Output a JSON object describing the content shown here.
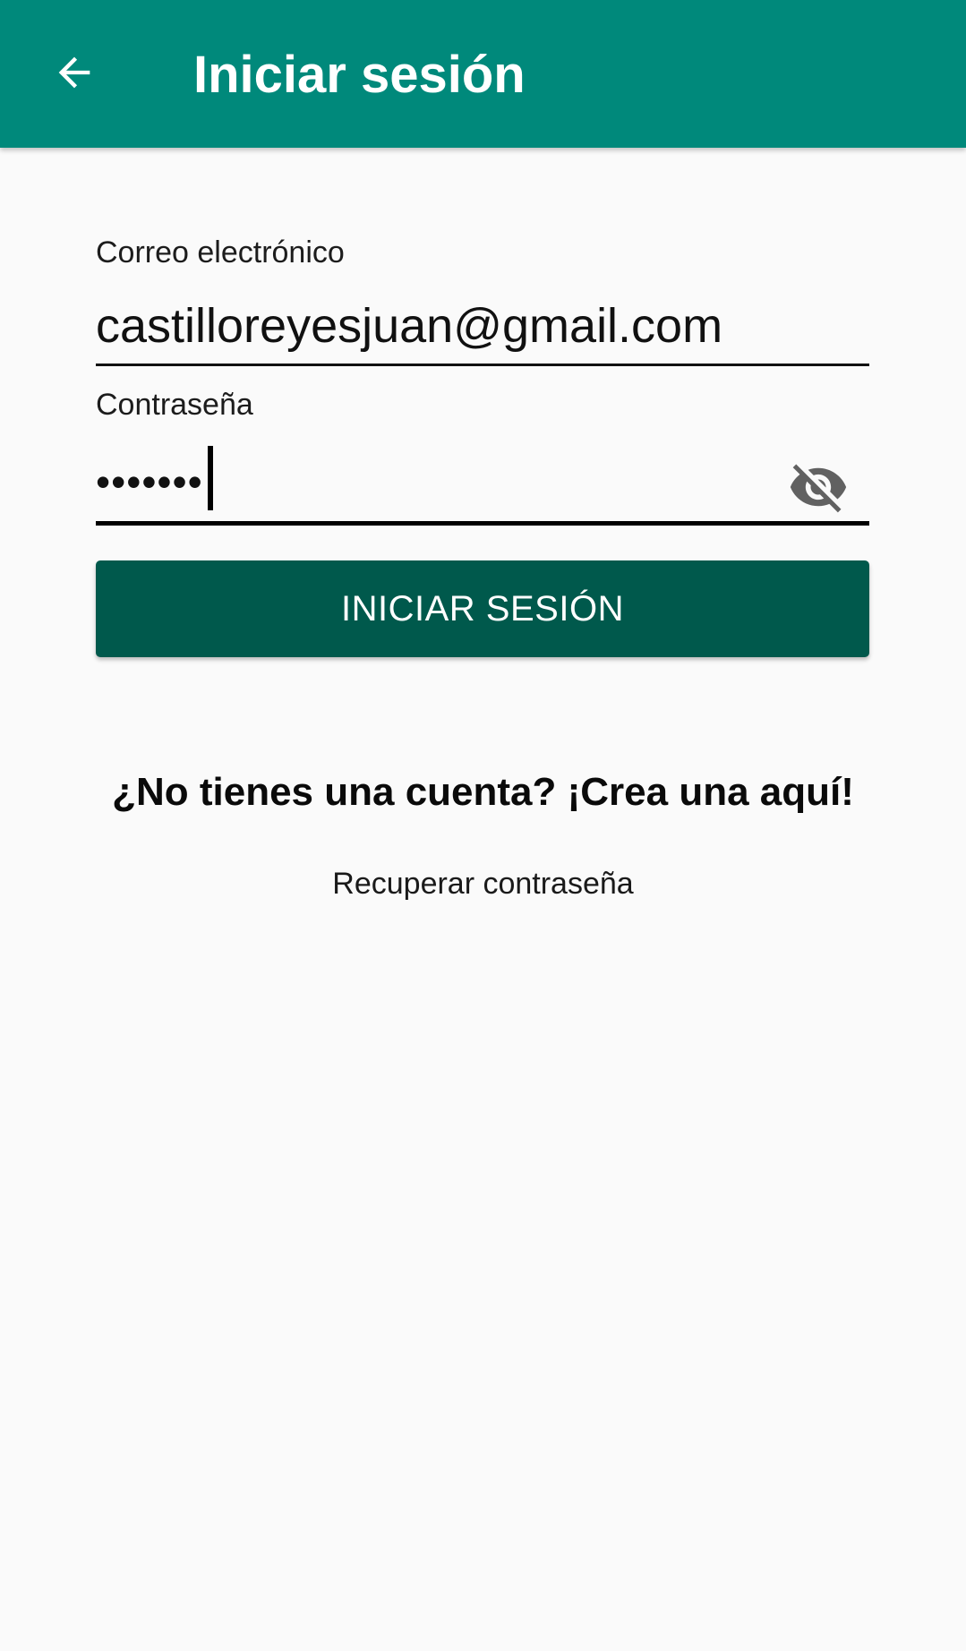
{
  "toolbar": {
    "back_icon": "arrow-back-icon",
    "title": "Iniciar sesión",
    "background_color": "#00897b"
  },
  "form": {
    "email": {
      "label": "Correo electrónico",
      "value": "castilloreyesjuan@gmail.com"
    },
    "password": {
      "label": "Contraseña",
      "value": "•••••••",
      "visibility_icon": "visibility-off-icon"
    },
    "submit_label": "INICIAR SESIÓN",
    "submit_color": "#00594c"
  },
  "links": {
    "signup": "¿No tienes una cuenta? ¡Crea una aquí!",
    "recover_password": "Recuperar contraseña"
  }
}
